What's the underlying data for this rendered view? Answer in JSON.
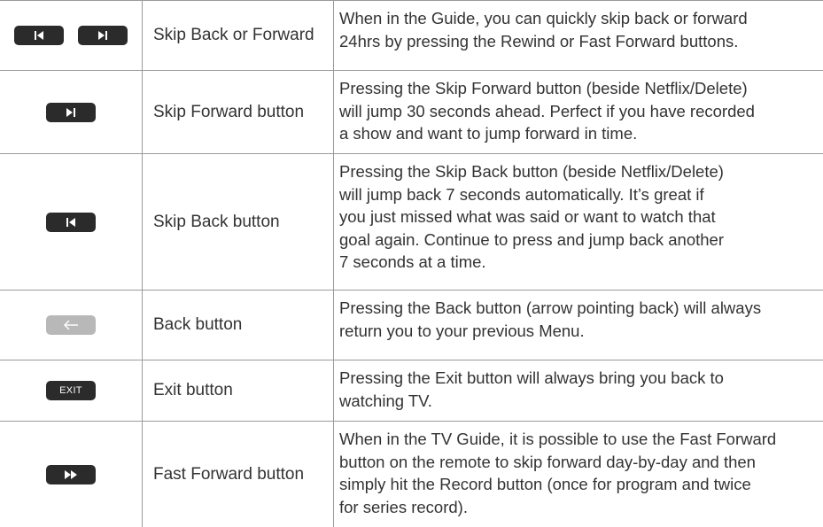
{
  "rows": [
    {
      "name": "Skip Back or Forward",
      "icons": [
        "skip-back-icon",
        "skip-forward-icon"
      ],
      "description_lines": [
        "When in the Guide, you can quickly skip back or forward",
        "24hrs by pressing the Rewind or Fast Forward buttons."
      ]
    },
    {
      "name": "Skip Forward button",
      "icons": [
        "skip-forward-icon"
      ],
      "description_lines": [
        "Pressing the Skip Forward button (beside Netflix/Delete)",
        "will jump 30 seconds ahead. Perfect if you have recorded",
        "a show and want to jump forward in time."
      ]
    },
    {
      "name": "Skip Back button",
      "icons": [
        "skip-back-icon"
      ],
      "description_lines": [
        "Pressing the Skip Back button (beside Netflix/Delete)",
        "will jump back 7 seconds automatically. It’s great if",
        "you just missed what was said or want to watch that",
        "goal again. Continue to press and jump back another",
        "7 seconds at a time."
      ]
    },
    {
      "name": "Back button",
      "icons": [
        "back-arrow-icon"
      ],
      "description_lines": [
        "Pressing the Back button (arrow pointing back) will always",
        "return you to your previous Menu."
      ]
    },
    {
      "name": "Exit button",
      "icons": [
        "exit-icon"
      ],
      "icon_text": "EXIT",
      "description_lines": [
        "Pressing the Exit button will always bring you back to",
        "watching TV."
      ]
    },
    {
      "name": "Fast Forward button",
      "icons": [
        "fast-forward-icon"
      ],
      "description_lines": [
        "When in the TV Guide, it is possible to use the Fast Forward",
        "button on the remote to skip forward day-by-day and then",
        "simply hit the Record button (once for program and twice",
        "for series record)."
      ]
    }
  ],
  "colors": {
    "button_dark": "#2b2b2b",
    "button_light": "#b8b8b8",
    "rule": "#9a9a9a",
    "text": "#333333"
  }
}
